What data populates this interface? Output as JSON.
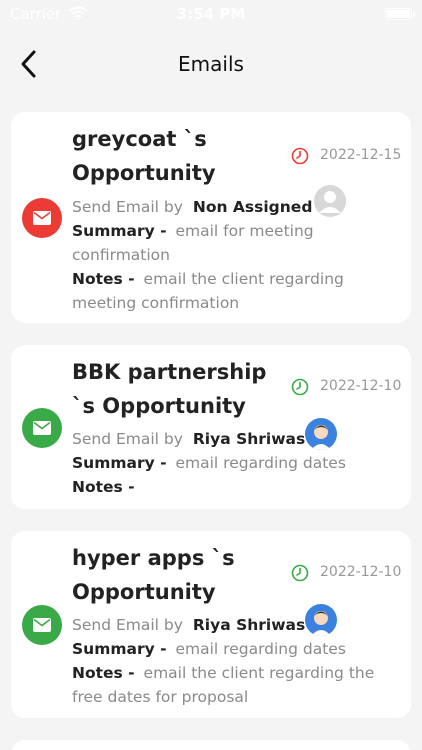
{
  "status_bar": {
    "carrier": "Carrier",
    "time": "3:54 PM"
  },
  "header": {
    "title": "Emails"
  },
  "colors": {
    "red": "#ec3a35",
    "green": "#3aaa48",
    "avatar_blue": "#3b82e0"
  },
  "cards": [
    {
      "title": "greycoat `s Opportunity",
      "date": "2022-12-15",
      "clock_color": "red",
      "icon": "mail-icon",
      "send_prefix": "Send Email by",
      "assignee": "Non Assigned",
      "avatar": "default-avatar-icon",
      "summary_label": "Summary -",
      "summary_text": "email for meeting confirmation",
      "notes_label": "Notes -",
      "notes_text": "email the client regarding meeting confirmation"
    },
    {
      "title": "BBK partnership `s Opportunity",
      "date": "2022-12-10",
      "clock_color": "green",
      "icon": "mail-icon",
      "send_prefix": "Send Email by",
      "assignee": "Riya Shriwas",
      "avatar": "user-avatar-icon",
      "summary_label": "Summary -",
      "summary_text": "email regarding dates",
      "notes_label": "Notes -",
      "notes_text": ""
    },
    {
      "title": "hyper apps `s Opportunity",
      "date": "2022-12-10",
      "clock_color": "green",
      "icon": "mail-icon",
      "send_prefix": "Send Email by",
      "assignee": "Riya Shriwas",
      "avatar": "user-avatar-icon",
      "summary_label": "Summary -",
      "summary_text": "email regarding dates",
      "notes_label": "Notes -",
      "notes_text": "email the client regarding the free dates for proposal"
    }
  ]
}
